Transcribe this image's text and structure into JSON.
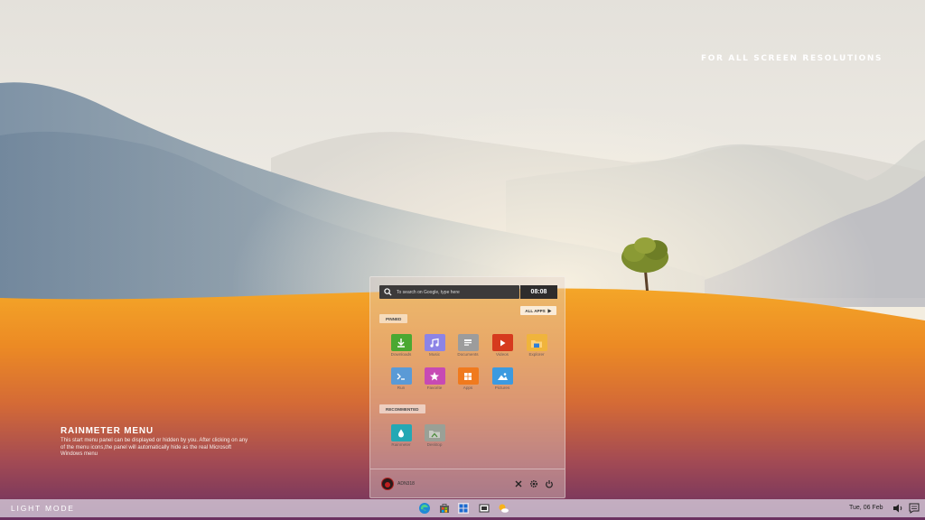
{
  "desktop": {
    "promo_text": "FOR ALL SCREEN RESOLUTIONS",
    "rainmeter_title": "RAINMETER MENU",
    "rainmeter_description": "This start menu panel can be displayed or hidden by you. After clicking on any of the menu icons,the panel will automatically hide as the real Microsoft Windows menu"
  },
  "start_menu": {
    "search_placeholder": "To search on Google, type here",
    "clock": "08:08",
    "all_apps_label": "ALL APPS",
    "pinned_label": "PINNED",
    "recommended_label": "RECOMMENTED",
    "pinned": [
      {
        "label": "Downloads",
        "icon": "download-icon",
        "color": "#4aa832"
      },
      {
        "label": "Music",
        "icon": "music-note-icon",
        "color": "#8c84e6"
      },
      {
        "label": "Documents",
        "icon": "document-icon",
        "color": "#9c9c9c"
      },
      {
        "label": "Videos",
        "icon": "play-icon",
        "color": "#d63a1e"
      },
      {
        "label": "Explorer",
        "icon": "folder-icon",
        "color": "#f0b43c"
      },
      {
        "label": "Run",
        "icon": "terminal-icon",
        "color": "#5a9ad6"
      },
      {
        "label": "Favorite",
        "icon": "star-icon",
        "color": "#c74ab4"
      },
      {
        "label": "Apps",
        "icon": "windows-icon",
        "color": "#f07a1e"
      },
      {
        "label": "Pictures",
        "icon": "picture-icon",
        "color": "#3c9ae0"
      }
    ],
    "recommended": [
      {
        "label": "Rainmeter",
        "icon": "drop-icon",
        "color": "#24a8b4"
      },
      {
        "label": "Desktop",
        "icon": "desktop-folder-icon",
        "color": "#9aa096"
      }
    ],
    "username": "ADN318"
  },
  "taskbar": {
    "mode_label": "LIGHT MODE",
    "date": "Tue, 06 Feb",
    "icons": [
      "edge-icon",
      "store-icon",
      "start-icon",
      "task-view-icon",
      "weather-icon"
    ]
  }
}
